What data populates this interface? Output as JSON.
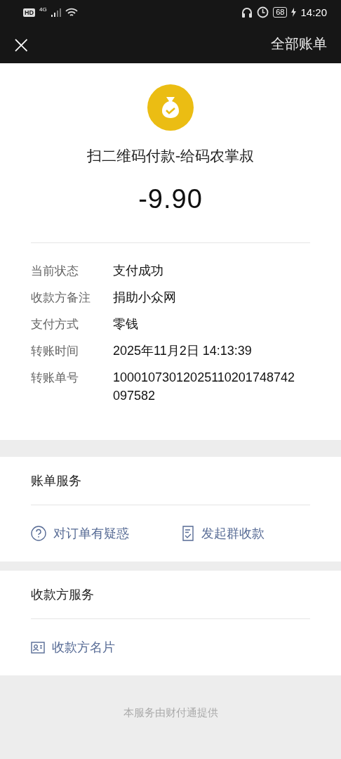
{
  "status_bar": {
    "hd": "HD",
    "network": "4G",
    "battery": "68",
    "time": "14:20"
  },
  "nav": {
    "close": "×",
    "action": "全部账单"
  },
  "payment": {
    "title": "扫二维码付款-给码农掌叔",
    "amount": "-9.90"
  },
  "details": [
    {
      "label": "当前状态",
      "value": "支付成功"
    },
    {
      "label": "收款方备注",
      "value": "捐助小众网"
    },
    {
      "label": "支付方式",
      "value": "零钱"
    },
    {
      "label": "转账时间",
      "value": "2025年11月2日 14:13:39"
    },
    {
      "label": "转账单号",
      "value": "10001073012025110201748742097582"
    }
  ],
  "sections": [
    {
      "title": "账单服务",
      "actions": [
        {
          "kind": "question",
          "label": "对订单有疑惑"
        },
        {
          "kind": "receipt",
          "label": "发起群收款"
        }
      ]
    },
    {
      "title": "收款方服务",
      "actions": [
        {
          "kind": "card",
          "label": "收款方名片"
        }
      ]
    }
  ],
  "footer": "本服务由财付通提供"
}
